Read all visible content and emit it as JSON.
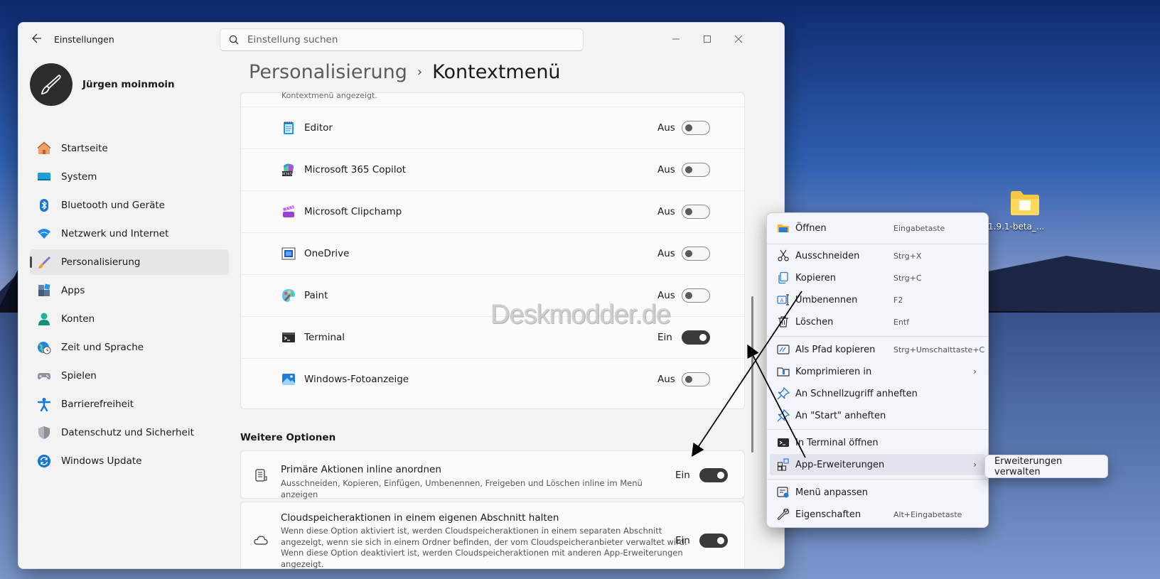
{
  "window": {
    "app_title": "Einstellungen",
    "search_placeholder": "Einstellung suchen",
    "user_name": "Jürgen moinmoin"
  },
  "nav": [
    {
      "label": "Startseite",
      "icon": "home-icon"
    },
    {
      "label": "System",
      "icon": "monitor-icon"
    },
    {
      "label": "Bluetooth und Geräte",
      "icon": "bluetooth-icon"
    },
    {
      "label": "Netzwerk und Internet",
      "icon": "wifi-icon"
    },
    {
      "label": "Personalisierung",
      "icon": "brush-icon",
      "active": true
    },
    {
      "label": "Apps",
      "icon": "apps-icon"
    },
    {
      "label": "Konten",
      "icon": "person-icon"
    },
    {
      "label": "Zeit und Sprache",
      "icon": "globe-clock-icon"
    },
    {
      "label": "Spielen",
      "icon": "gamepad-icon"
    },
    {
      "label": "Barrierefreiheit",
      "icon": "accessibility-icon"
    },
    {
      "label": "Datenschutz und Sicherheit",
      "icon": "shield-icon"
    },
    {
      "label": "Windows Update",
      "icon": "update-icon"
    }
  ],
  "breadcrumb": {
    "parent": "Personalisierung",
    "separator": "›",
    "current": "Kontextmenü"
  },
  "apps_caption": "Kontextmenü angezeigt.",
  "apps": [
    {
      "label": "Editor",
      "state": "Aus",
      "on": false,
      "icon": "notepad-icon"
    },
    {
      "label": "Microsoft 365 Copilot",
      "state": "Aus",
      "on": false,
      "icon": "m365-icon"
    },
    {
      "label": "Microsoft Clipchamp",
      "state": "Aus",
      "on": false,
      "icon": "clipchamp-icon"
    },
    {
      "label": "OneDrive",
      "state": "Aus",
      "on": false,
      "icon": "onedrive-icon"
    },
    {
      "label": "Paint",
      "state": "Aus",
      "on": false,
      "icon": "paint-icon"
    },
    {
      "label": "Terminal",
      "state": "Ein",
      "on": true,
      "icon": "terminal-icon"
    },
    {
      "label": "Windows-Fotoanzeige",
      "state": "Aus",
      "on": false,
      "icon": "photo-viewer-icon"
    }
  ],
  "more_options_title": "Weitere Optionen",
  "options": [
    {
      "title": "Primäre Aktionen inline anordnen",
      "desc": "Ausschneiden, Kopieren, Einfügen, Umbenennen, Freigeben und Löschen inline im Menü anzeigen",
      "state": "Ein",
      "on": true
    },
    {
      "title": "Cloudspeicheraktionen in einem eigenen Abschnitt halten",
      "desc1": "Wenn diese Option aktiviert ist, werden Cloudspeicheraktionen in einem separaten Abschnitt",
      "desc2": "angezeigt, wenn sie sich in einem Ordner befinden, der vom Cloudspeicheranbieter verwaltet wird.",
      "desc3": "Wenn diese Option deaktiviert ist, werden Cloudspeicheraktionen mit anderen App-Erweiterungen",
      "desc4": "angezeigt.",
      "state": "Ein",
      "on": true
    }
  ],
  "watermark": "Deskmodder.de",
  "desktop_icon_label": "1.9.1-beta_...",
  "context_menu": [
    {
      "label": "Öffnen",
      "key": "Eingabetaste",
      "icon": "folder-open-icon"
    },
    {
      "label": "Ausschneiden",
      "key": "Strg+X",
      "icon": "scissors-icon"
    },
    {
      "label": "Kopieren",
      "key": "Strg+C",
      "icon": "copy-icon"
    },
    {
      "label": "Umbenennen",
      "key": "F2",
      "icon": "rename-icon"
    },
    {
      "label": "Löschen",
      "key": "Entf",
      "icon": "trash-icon"
    },
    {
      "label": "Als Pfad kopieren",
      "key": "Strg+Umschalttaste+C",
      "icon": "copy-path-icon"
    },
    {
      "label": "Komprimieren in",
      "key": "",
      "icon": "zip-icon",
      "submenu": true
    },
    {
      "label": "An Schnellzugriff anheften",
      "key": "",
      "icon": "pin-icon"
    },
    {
      "label": "An \"Start\" anheften",
      "key": "",
      "icon": "pin-icon"
    },
    {
      "label": "In Terminal öffnen",
      "key": "",
      "icon": "terminal-icon"
    },
    {
      "label": "App-Erweiterungen",
      "key": "",
      "icon": "app-extensions-icon",
      "submenu": true
    },
    {
      "label": "Menü anpassen",
      "key": "",
      "icon": "customize-menu-icon"
    },
    {
      "label": "Eigenschaften",
      "key": "Alt+Eingabetaste",
      "icon": "wrench-icon"
    }
  ],
  "submenu_item": "Erweiterungen verwalten",
  "colors": {
    "toggle_on": "#3a3a3a",
    "window_bg": "#f3f3f3",
    "card_bg": "#fbfbfb"
  }
}
